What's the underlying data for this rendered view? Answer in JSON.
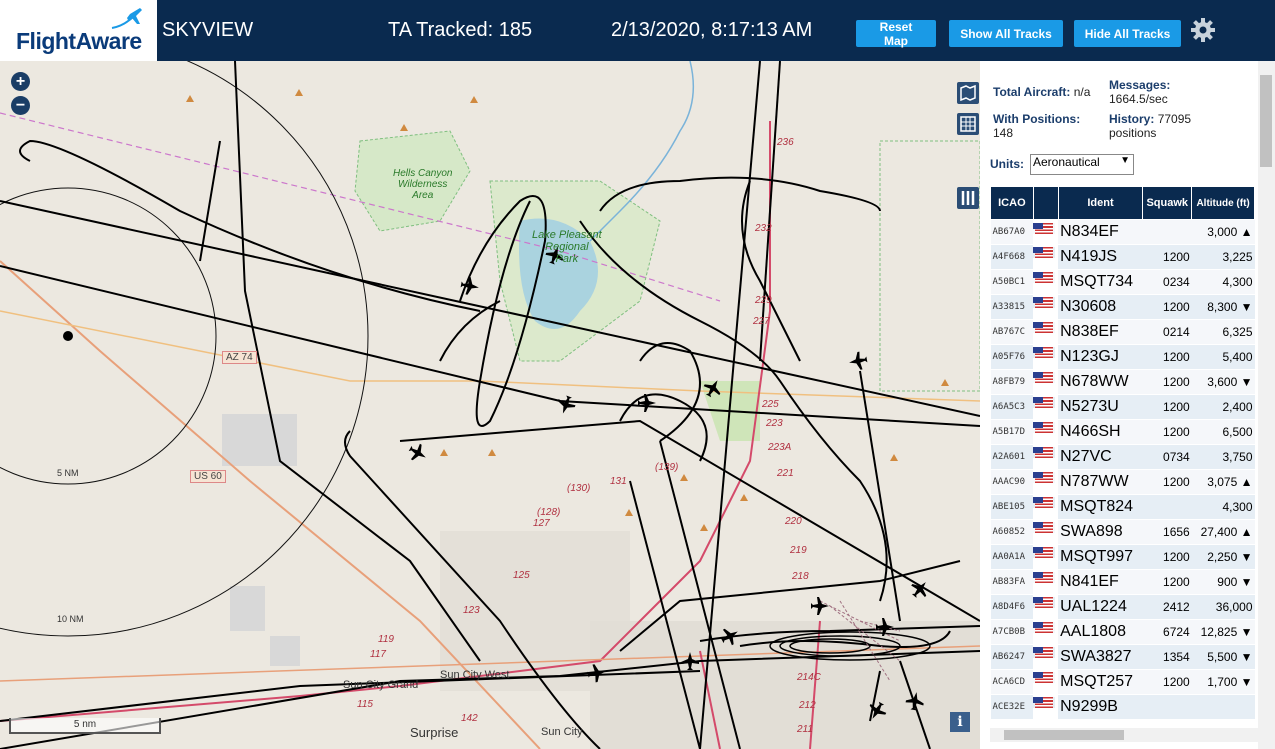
{
  "header": {
    "logo": "FlightAware",
    "site_name": "SKYVIEW",
    "tracked": "TA Tracked: 185",
    "datetime": "2/13/2020, 8:17:13 AM",
    "reset_label": "Reset Map",
    "show_label": "Show All Tracks",
    "hide_label": "Hide All Tracks",
    "gear_icon": "gear-icon"
  },
  "map": {
    "zoom_in": "+",
    "zoom_out": "−",
    "scale": "5 nm",
    "info": "i",
    "labels": {
      "hells_canyon": "Hells Canyon\nWilderness\nArea",
      "lake_pleasant": "Lake Pleasant\nRegional\nPark",
      "az74": "AZ 74",
      "us60": "US 60",
      "ring5": "5 NM",
      "ring10": "10 NM",
      "sun_city_grand": "Sun City Grand",
      "sun_city_west": "Sun City West",
      "surprise": "Surprise",
      "sun_city": "Sun City",
      "r236": "236",
      "r232": "232",
      "r229": "229",
      "r227": "227",
      "r225": "225",
      "r223": "223",
      "r223a": "223A",
      "r221": "221",
      "r220": "220",
      "r219": "219",
      "r218": "218",
      "r139": "(139)",
      "r131": "131",
      "r130": "(130)",
      "r128": "(128)",
      "r127": "127",
      "r125": "125",
      "r123": "123",
      "r119": "119",
      "r117": "117",
      "r115": "115",
      "r142": "142",
      "r214c": "214C",
      "r212": "212",
      "r211": "211"
    }
  },
  "sidebar": {
    "total_label": "Total Aircraft:",
    "total_value": "n/a",
    "with_pos_label": "With Positions:",
    "with_pos_value": "148",
    "messages_label": "Messages:",
    "messages_value": "1664.5/sec",
    "history_label": "History:",
    "history_value": "77095",
    "history_unit": "positions",
    "units_label": "Units:",
    "units_value": "Aeronautical",
    "columns": [
      "ICAO",
      "",
      "Ident",
      "Squawk",
      "Altitude (ft)"
    ],
    "rows": [
      {
        "icao": "AB67A0",
        "ident": "N834EF",
        "squawk": "",
        "alt": "3,000 ▲"
      },
      {
        "icao": "A4F668",
        "ident": "N419JS",
        "squawk": "1200",
        "alt": "3,225"
      },
      {
        "icao": "A50BC1",
        "ident": "MSQT734",
        "squawk": "0234",
        "alt": "4,300"
      },
      {
        "icao": "A33815",
        "ident": "N30608",
        "squawk": "1200",
        "alt": "8,300 ▼"
      },
      {
        "icao": "AB767C",
        "ident": "N838EF",
        "squawk": "0214",
        "alt": "6,325"
      },
      {
        "icao": "A05F76",
        "ident": "N123GJ",
        "squawk": "1200",
        "alt": "5,400"
      },
      {
        "icao": "A8FB79",
        "ident": "N678WW",
        "squawk": "1200",
        "alt": "3,600 ▼"
      },
      {
        "icao": "A6A5C3",
        "ident": "N5273U",
        "squawk": "1200",
        "alt": "2,400"
      },
      {
        "icao": "A5B17D",
        "ident": "N466SH",
        "squawk": "1200",
        "alt": "6,500"
      },
      {
        "icao": "A2A601",
        "ident": "N27VC",
        "squawk": "0734",
        "alt": "3,750"
      },
      {
        "icao": "AAAC90",
        "ident": "N787WW",
        "squawk": "1200",
        "alt": "3,075 ▲"
      },
      {
        "icao": "ABE105",
        "ident": "MSQT824",
        "squawk": "",
        "alt": "4,300"
      },
      {
        "icao": "A60852",
        "ident": "SWA898",
        "squawk": "1656",
        "alt": "27,400 ▲"
      },
      {
        "icao": "AA0A1A",
        "ident": "MSQT997",
        "squawk": "1200",
        "alt": "2,250 ▼"
      },
      {
        "icao": "AB83FA",
        "ident": "N841EF",
        "squawk": "1200",
        "alt": "900 ▼"
      },
      {
        "icao": "A8D4F6",
        "ident": "UAL1224",
        "squawk": "2412",
        "alt": "36,000"
      },
      {
        "icao": "A7CB0B",
        "ident": "AAL1808",
        "squawk": "6724",
        "alt": "12,825 ▼"
      },
      {
        "icao": "AB6247",
        "ident": "SWA3827",
        "squawk": "1354",
        "alt": "5,500 ▼"
      },
      {
        "icao": "ACA6CD",
        "ident": "MSQT257",
        "squawk": "1200",
        "alt": "1,700 ▼"
      },
      {
        "icao": "ACE32E",
        "ident": "N9299B",
        "squawk": "",
        "alt": ""
      }
    ]
  }
}
